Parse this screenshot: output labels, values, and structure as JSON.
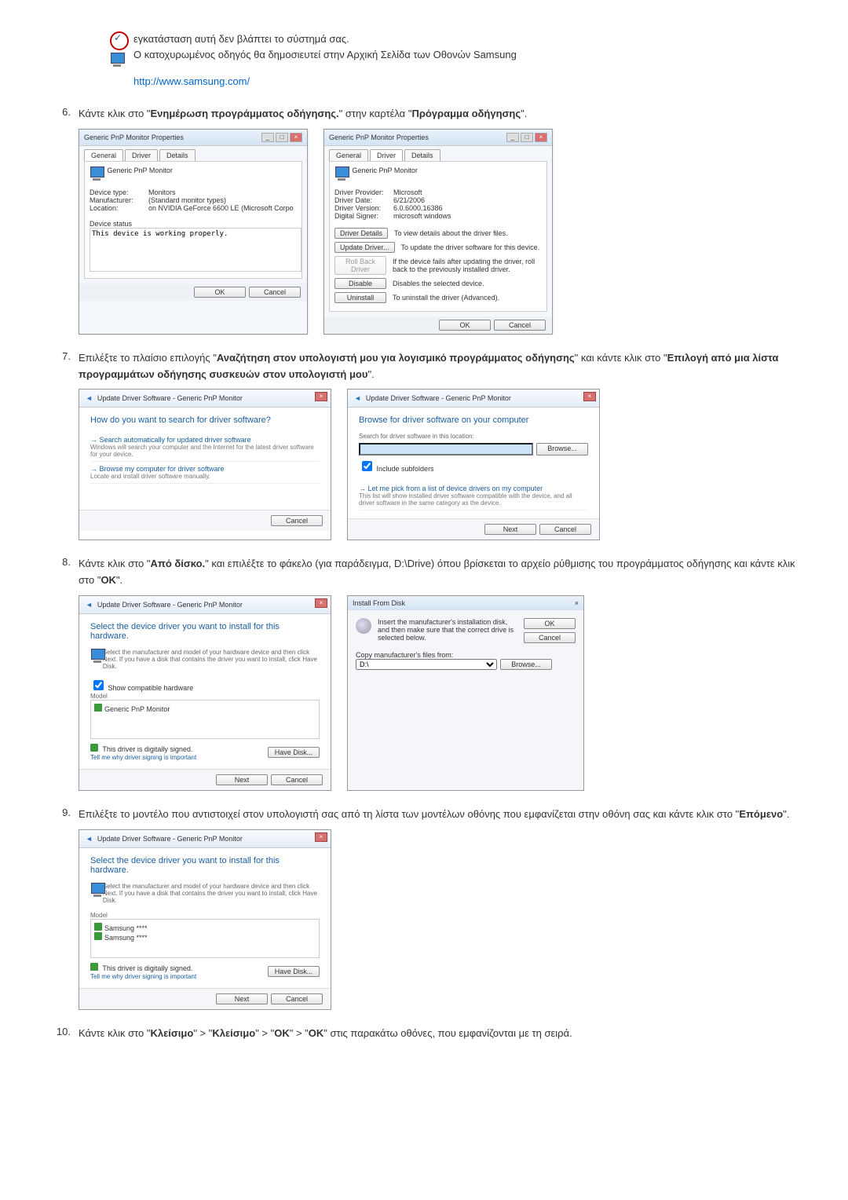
{
  "intro": {
    "line1": "εγκατάσταση αυτή δεν βλάπτει το σύστημά σας.",
    "line2": "Ο κατοχυρωμένος οδηγός θα δημοσιευτεί στην Αρχική Σελίδα των Οθονών Samsung",
    "link": "http://www.samsung.com/"
  },
  "steps": {
    "s6": {
      "num": "6.",
      "pre": "Κάντε κλικ στο \"",
      "bold1": "Ενημέρωση προγράμματος οδήγησης.",
      "mid": "\" στην καρτέλα \"",
      "bold2": "Πρόγραμμα οδήγησης",
      "post": "\"."
    },
    "s7": {
      "num": "7.",
      "pre": "Επιλέξτε το πλαίσιο επιλογής \"",
      "bold1": "Αναζήτηση στον υπολογιστή μου για λογισμικό προγράμματος οδήγησης",
      "mid": "\" και κάντε κλικ στο \"",
      "bold2": "Επιλογή από μια λίστα προγραμμάτων οδήγησης συσκευών στον υπολογιστή μου",
      "post": "\"."
    },
    "s8": {
      "num": "8.",
      "pre": "Κάντε κλικ στο \"",
      "bold1": "Από δίσκο.",
      "mid": "\" και επιλέξτε το φάκελο (για παράδειγμα, D:\\Drive) όπου βρίσκεται το αρχείο ρύθμισης του προγράμματος οδήγησης και κάντε κλικ στο \"",
      "bold2": "OK",
      "post": "\"."
    },
    "s9": {
      "num": "9.",
      "pre": "Επιλέξτε το μοντέλο που αντιστοιχεί στον υπολογιστή σας από τη λίστα των μοντέλων οθόνης που εμφανίζεται στην οθόνη σας και κάντε κλικ στο \"",
      "bold1": "Επόμενο",
      "post": "\"."
    },
    "s10": {
      "num": "10.",
      "pre": "Κάντε κλικ στο \"",
      "b1": "Κλείσιμο",
      "m1": "\" > \"",
      "b2": "Κλείσιμο",
      "m2": "\" > \"",
      "b3": "OK",
      "m3": "\" > \"",
      "b4": "OK",
      "post": "\" στις παρακάτω οθόνες, που εμφανίζονται με τη σειρά."
    }
  },
  "dlg_general": {
    "title": "Generic PnP Monitor Properties",
    "tabs": {
      "general": "General",
      "driver": "Driver",
      "details": "Details"
    },
    "heading": "Generic PnP Monitor",
    "device_type_l": "Device type:",
    "device_type_v": "Monitors",
    "manufacturer_l": "Manufacturer:",
    "manufacturer_v": "(Standard monitor types)",
    "location_l": "Location:",
    "location_v": "on NVIDIA GeForce 6600 LE (Microsoft Corpo",
    "status_l": "Device status",
    "status_v": "This device is working properly.",
    "ok": "OK",
    "cancel": "Cancel"
  },
  "dlg_driver": {
    "title": "Generic PnP Monitor Properties",
    "heading": "Generic PnP Monitor",
    "provider_l": "Driver Provider:",
    "provider_v": "Microsoft",
    "date_l": "Driver Date:",
    "date_v": "6/21/2006",
    "version_l": "Driver Version:",
    "version_v": "6.0.6000.16386",
    "signer_l": "Digital Signer:",
    "signer_v": "microsoft windows",
    "btn_details": "Driver Details",
    "desc_details": "To view details about the driver files.",
    "btn_update": "Update Driver...",
    "desc_update": "To update the driver software for this device.",
    "btn_rollback": "Roll Back Driver",
    "desc_rollback": "If the device fails after updating the driver, roll back to the previously installed driver.",
    "btn_disable": "Disable",
    "desc_disable": "Disables the selected device.",
    "btn_uninstall": "Uninstall",
    "desc_uninstall": "To uninstall the driver (Advanced).",
    "ok": "OK",
    "cancel": "Cancel"
  },
  "wiz": {
    "breadcrumb": "Update Driver Software - Generic PnP Monitor",
    "q_search": "How do you want to search for driver software?",
    "opt1": "Search automatically for updated driver software",
    "opt1d": "Windows will search your computer and the Internet for the latest driver software for your device.",
    "opt2": "Browse my computer for driver software",
    "opt2d": "Locate and install driver software manually.",
    "cancel": "Cancel",
    "browse_title": "Browse for driver software on your computer",
    "search_loc": "Search for driver software in this location:",
    "browse_btn": "Browse...",
    "include_sub": "Include subfolders",
    "pick_list": "Let me pick from a list of device drivers on my computer",
    "pick_list_d": "This list will show installed driver software compatible with the device, and all driver software in the same category as the device.",
    "next": "Next",
    "select_title": "Select the device driver you want to install for this hardware.",
    "select_desc": "Select the manufacturer and model of your hardware device and then click Next. If you have a disk that contains the driver you want to install, click Have Disk.",
    "show_compat": "Show compatible hardware",
    "model": "Model",
    "model_item": "Generic PnP Monitor",
    "samsung1": "Samsung ****",
    "samsung2": "Samsung ****",
    "signed": "This driver is digitally signed.",
    "signed_link": "Tell me why driver signing is important",
    "have_disk": "Have Disk..."
  },
  "install_disk": {
    "title": "Install From Disk",
    "msg": "Insert the manufacturer's installation disk, and then make sure that the correct drive is selected below.",
    "ok": "OK",
    "cancel": "Cancel",
    "copy_from": "Copy manufacturer's files from:",
    "combo": "D:\\",
    "browse": "Browse..."
  }
}
